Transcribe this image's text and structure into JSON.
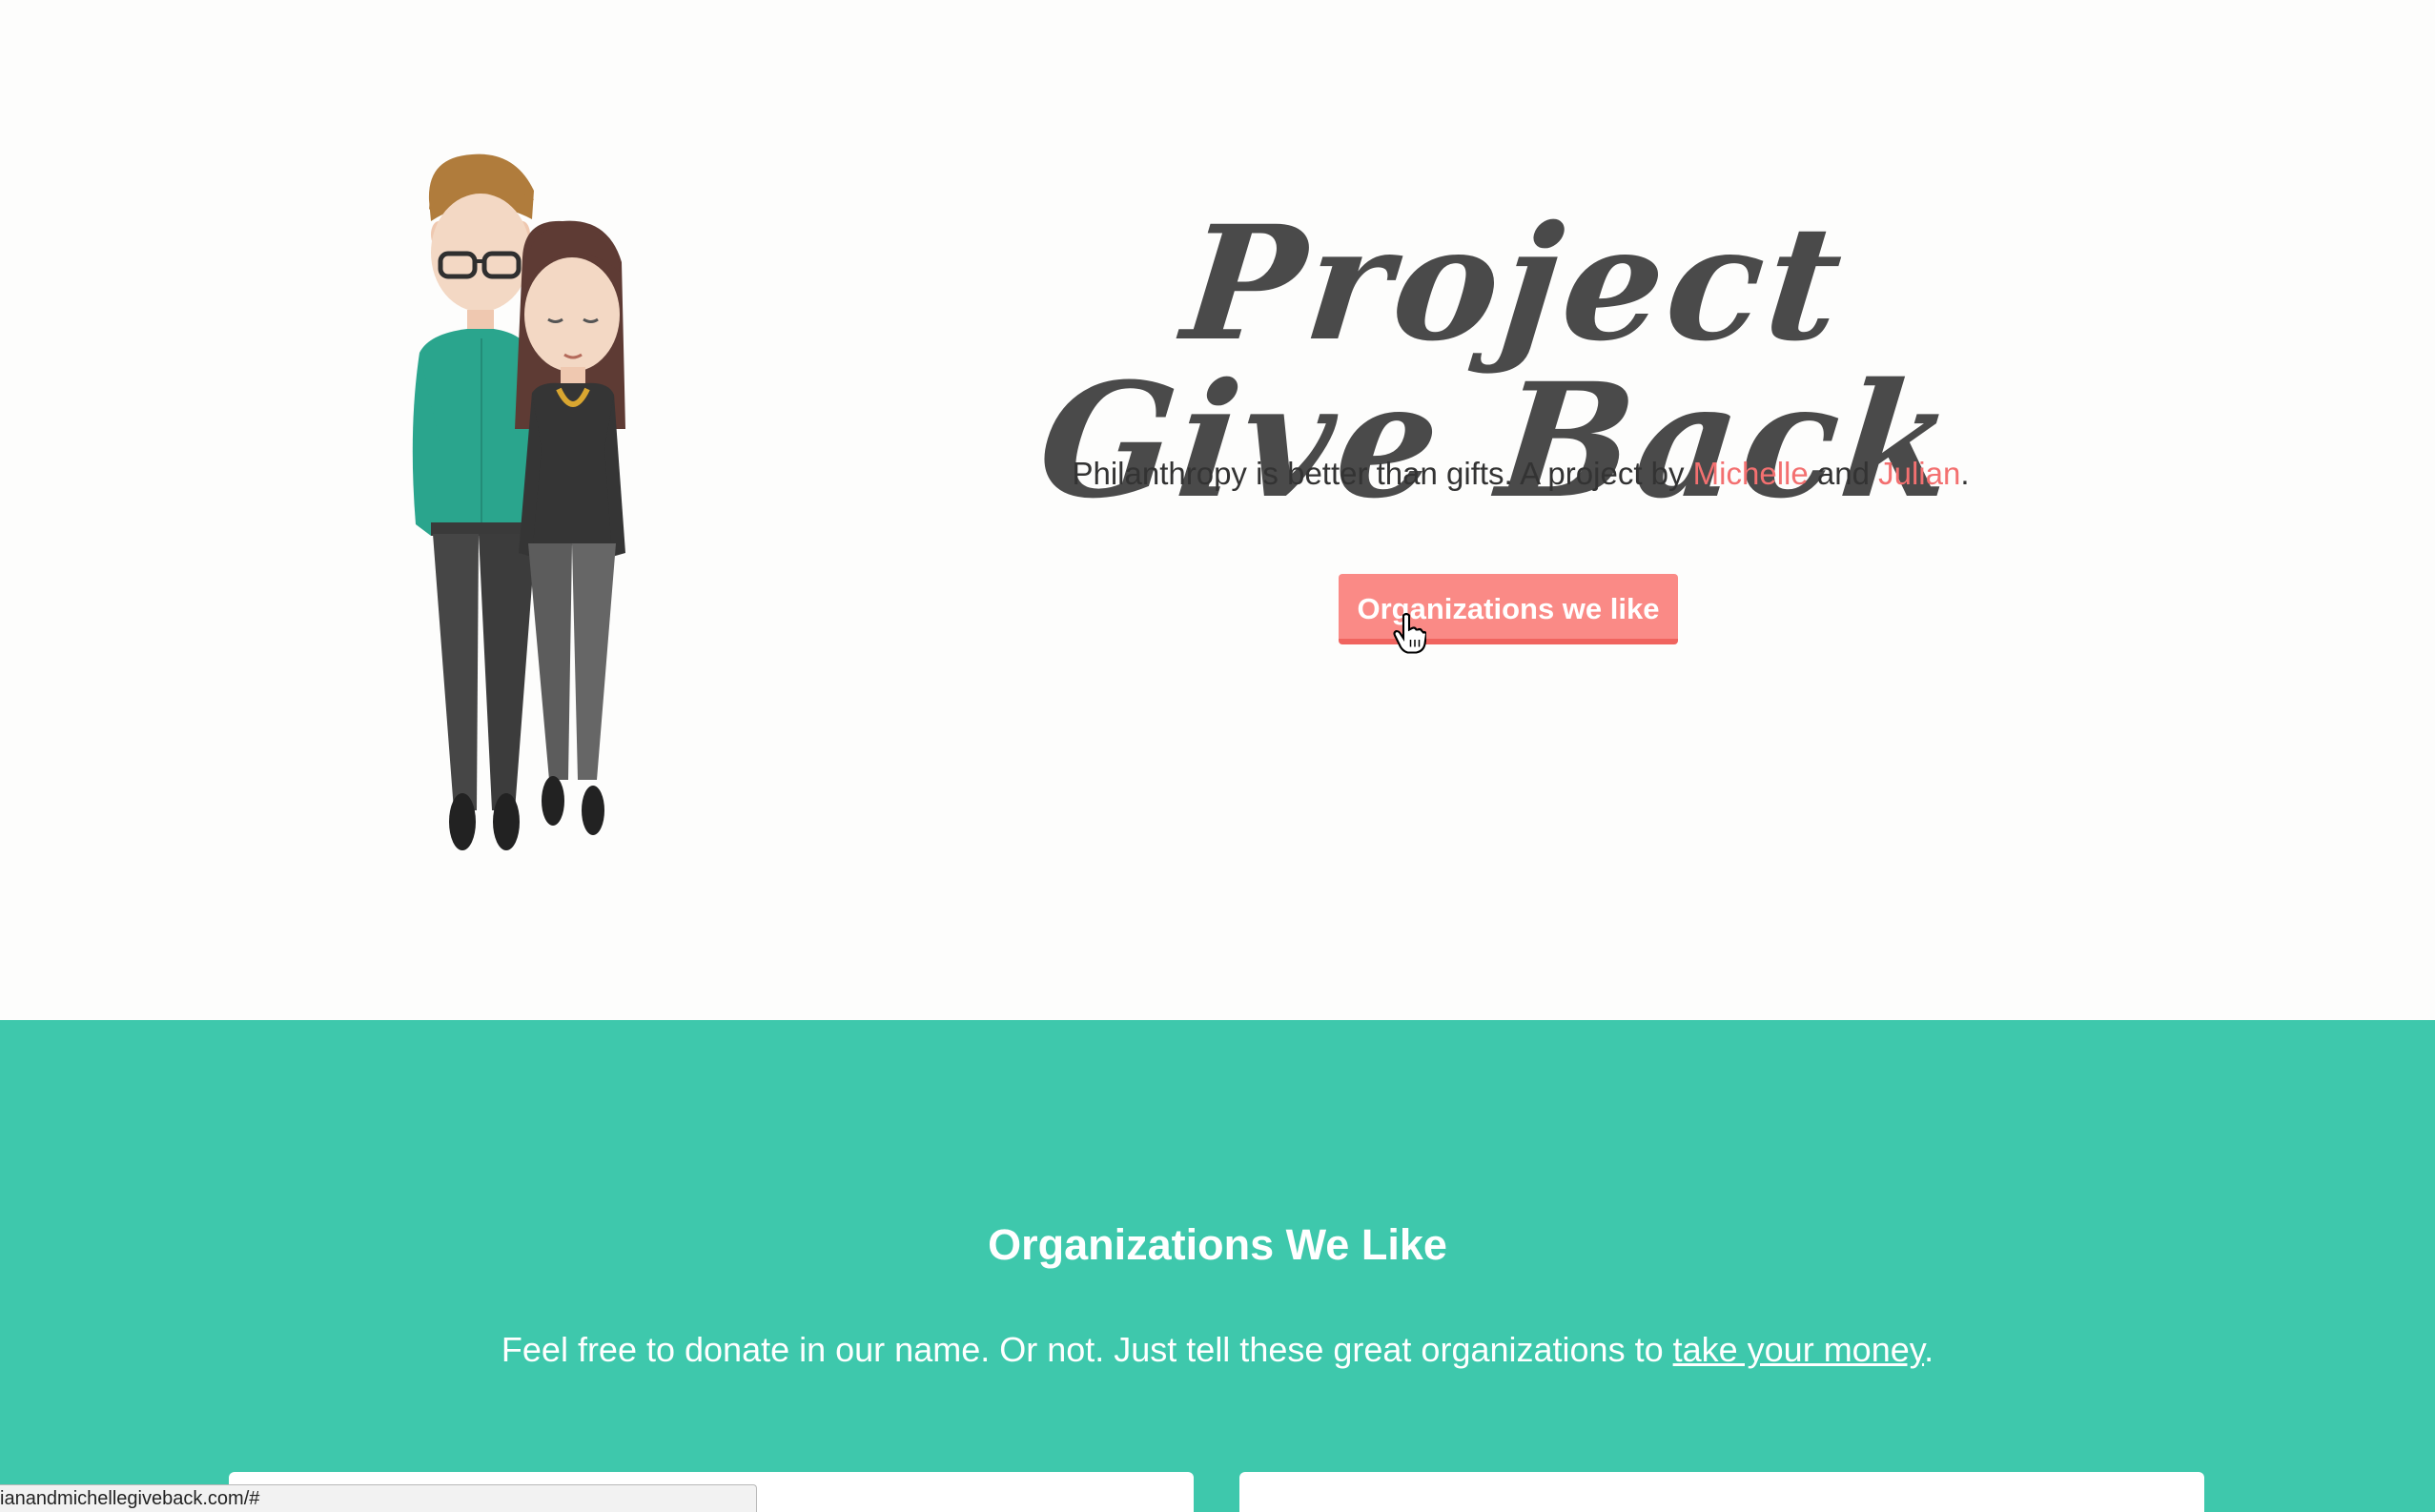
{
  "hero": {
    "title": "Project Give Back",
    "tagline_prefix": "Philanthropy is better than gifts. A project by ",
    "name1": "Michelle",
    "conj": " and ",
    "name2": "Julian",
    "tagline_suffix": ".",
    "cta_label": "Organizations we like"
  },
  "orgs": {
    "title": "Organizations We Like",
    "subtitle_prefix": "Feel free to donate in our name. Or not. Just tell these great organizations to ",
    "subtitle_link": "take your money",
    "subtitle_suffix": "."
  },
  "status_bar": {
    "url": "ianandmichellegiveback.com/#"
  },
  "colors": {
    "accent": "#fa8a86",
    "accent_text": "#f37070",
    "teal": "#3ec8ac",
    "hero_bg": "#fdfdfc"
  }
}
